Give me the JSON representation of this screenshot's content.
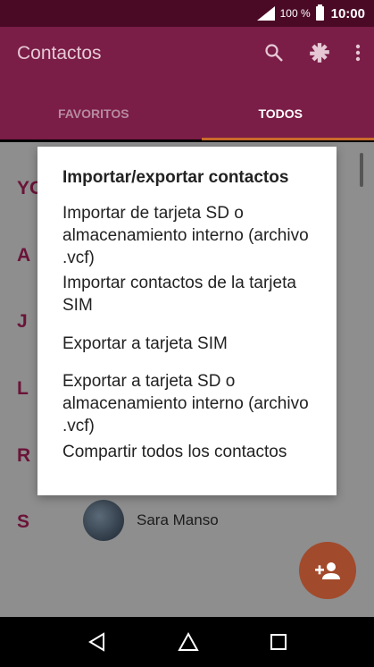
{
  "status_bar": {
    "battery_text": "100 %",
    "time": "10:00"
  },
  "app_bar": {
    "title": "Contactos",
    "actions": [
      "search-icon",
      "settings-icon",
      "more-vert-icon"
    ],
    "tabs": [
      {
        "label": "FAVORITOS"
      },
      {
        "label": "TODOS"
      }
    ],
    "color": "#7a1d47"
  },
  "list": {
    "letters": [
      "YO",
      "A",
      "J",
      "L",
      "R",
      "S"
    ],
    "contacts": [
      {
        "name": "Sara Manso"
      }
    ]
  },
  "dialog": {
    "title": "Importar/exportar contactos",
    "items": [
      {
        "label": "Importar de tarjeta SD o almacenamiento interno (archivo .vcf)"
      },
      {
        "label": "Importar contactos de la tarjeta SIM"
      },
      {
        "label": "Exportar a tarjeta SIM"
      },
      {
        "label": "Exportar a tarjeta SD o almacenamiento interno (archivo .vcf)"
      },
      {
        "label": "Compartir todos los contactos"
      }
    ]
  },
  "fab": {
    "icon": "add-person-icon",
    "color": "#a24a2c"
  },
  "nav_bar": {
    "icons": [
      "back-icon",
      "home-icon",
      "recents-icon"
    ]
  }
}
